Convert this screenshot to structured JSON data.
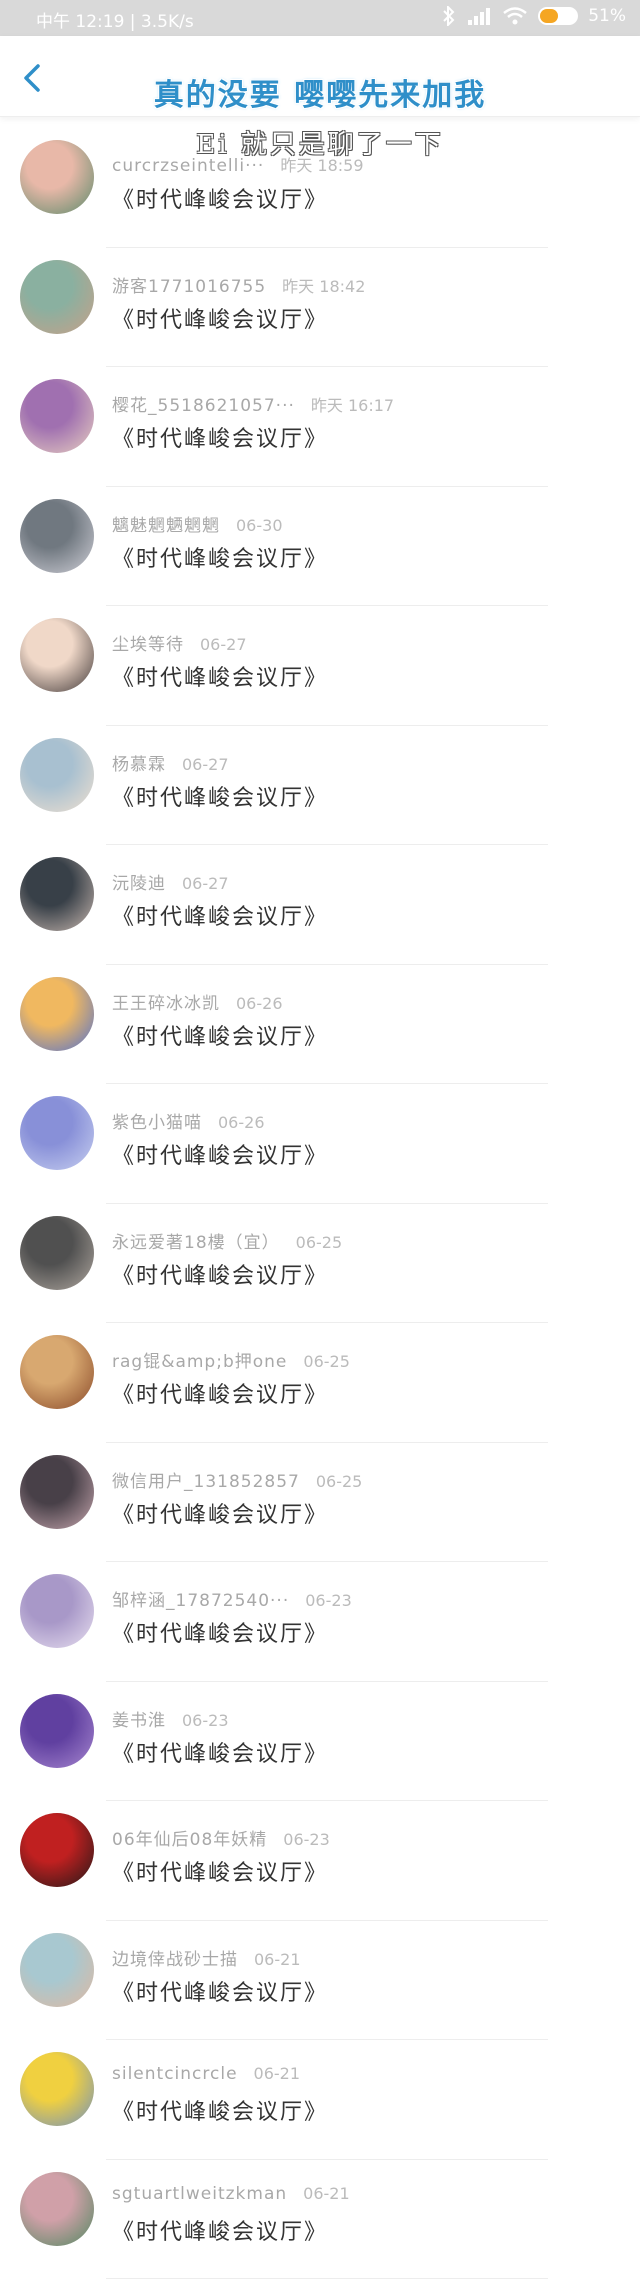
{
  "status_bar": {
    "time_text": "中午 12:19 | 3.5K/s",
    "battery_text": "51%",
    "battery_level": 0.51
  },
  "header": {
    "title": "真的没要 嘤嘤先来加我",
    "back_icon": "chevron-left-icon",
    "accent_color": "#2f8fc9"
  },
  "caption": "Ei 就只是聊了一下",
  "contacts": [
    {
      "name": "curcrzseintelli···",
      "time": "昨天 18:59",
      "message": "《时代峰峻会议厅》",
      "avatar_colors": [
        "#e8b8a8",
        "#5a8a6a"
      ]
    },
    {
      "name": "游客1771016755",
      "time": "昨天 18:42",
      "message": "《时代峰峻会议厅》",
      "avatar_colors": [
        "#8ab0a0",
        "#c8a088"
      ]
    },
    {
      "name": "樱花_5518621057···",
      "time": "昨天 16:17",
      "message": "《时代峰峻会议厅》",
      "avatar_colors": [
        "#a070b0",
        "#e8d0c0"
      ]
    },
    {
      "name": "魑魅魍魉魍魍",
      "time": "06-30",
      "message": "《时代峰峻会议厅》",
      "avatar_colors": [
        "#707880",
        "#d0d0d8"
      ]
    },
    {
      "name": "尘埃等待",
      "time": "06-27",
      "message": "《时代峰峻会议厅》",
      "avatar_colors": [
        "#f0d8c8",
        "#403838"
      ]
    },
    {
      "name": "杨慕霖",
      "time": "06-27",
      "message": "《时代峰峻会议厅》",
      "avatar_colors": [
        "#a8c0d0",
        "#f0e0d0"
      ]
    },
    {
      "name": "沅陵迪",
      "time": "06-27",
      "message": "《时代峰峻会议厅》",
      "avatar_colors": [
        "#384048",
        "#c8b8b0"
      ]
    },
    {
      "name": "王王碎冰冰凯",
      "time": "06-26",
      "message": "《时代峰峻会议厅》",
      "avatar_colors": [
        "#f0b860",
        "#5070d0"
      ]
    },
    {
      "name": "紫色小猫喵",
      "time": "06-26",
      "message": "《时代峰峻会议厅》",
      "avatar_colors": [
        "#8890d8",
        "#c8d0f0"
      ]
    },
    {
      "name": "永远爱著18樓（宜）",
      "time": "06-25",
      "message": "《时代峰峻会议厅》",
      "avatar_colors": [
        "#505050",
        "#b0a8a0"
      ]
    },
    {
      "name": "rag锟&amp;b押one",
      "time": "06-25",
      "message": "《时代峰峻会议厅》",
      "avatar_colors": [
        "#d8a870",
        "#884828"
      ]
    },
    {
      "name": "微信用户_131852857",
      "time": "06-25",
      "message": "《时代峰峻会议厅》",
      "avatar_colors": [
        "#484048",
        "#c8a8b0"
      ]
    },
    {
      "name": "邹梓涵_17872540···",
      "time": "06-23",
      "message": "《时代峰峻会议厅》",
      "avatar_colors": [
        "#a898c8",
        "#e8e0f0"
      ]
    },
    {
      "name": "姜书淮",
      "time": "06-23",
      "message": "《时代峰峻会议厅》",
      "avatar_colors": [
        "#6040a0",
        "#a888d0"
      ]
    },
    {
      "name": "06年仙后08年妖精",
      "time": "06-23",
      "message": "《时代峰峻会议厅》",
      "avatar_colors": [
        "#c02020",
        "#201818"
      ]
    },
    {
      "name": "边境倖战砂士描",
      "time": "06-21",
      "message": "《时代峰峻会议厅》",
      "avatar_colors": [
        "#a8c8d0",
        "#e0b8a0"
      ]
    },
    {
      "name": "silentcincrcle",
      "time": "06-21",
      "message": "《时代峰峻会议厅》",
      "avatar_colors": [
        "#f0d040",
        "#7090c0"
      ]
    },
    {
      "name": "sgtuartlweitzkman",
      "time": "06-21",
      "message": "《时代峰峻会议厅》",
      "avatar_colors": [
        "#d0a0a8",
        "#508860"
      ]
    }
  ]
}
